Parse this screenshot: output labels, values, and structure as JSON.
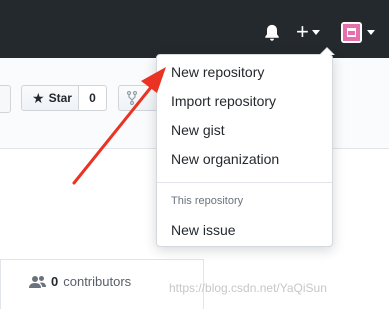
{
  "dropdown": {
    "items": [
      {
        "label": "New repository"
      },
      {
        "label": "Import repository"
      },
      {
        "label": "New gist"
      },
      {
        "label": "New organization"
      }
    ],
    "section_header": "This repository",
    "section_items": [
      {
        "label": "New issue"
      }
    ]
  },
  "repo_actions": {
    "star_label": "Star",
    "star_count": "0"
  },
  "stats": {
    "contributors_count": "0",
    "contributors_label": "contributors"
  },
  "watermark": "https://blog.csdn.net/YaQiSun",
  "colors": {
    "header_bg": "#24292e",
    "annotation_arrow": "#ea3323",
    "avatar_pink": "#e76fae"
  },
  "icons": {
    "notifications": "bell-icon",
    "create_new": "plus-icon",
    "avatar": "identicon-avatar",
    "star": "star-icon",
    "fork": "fork-icon",
    "contributors": "people-icon"
  }
}
